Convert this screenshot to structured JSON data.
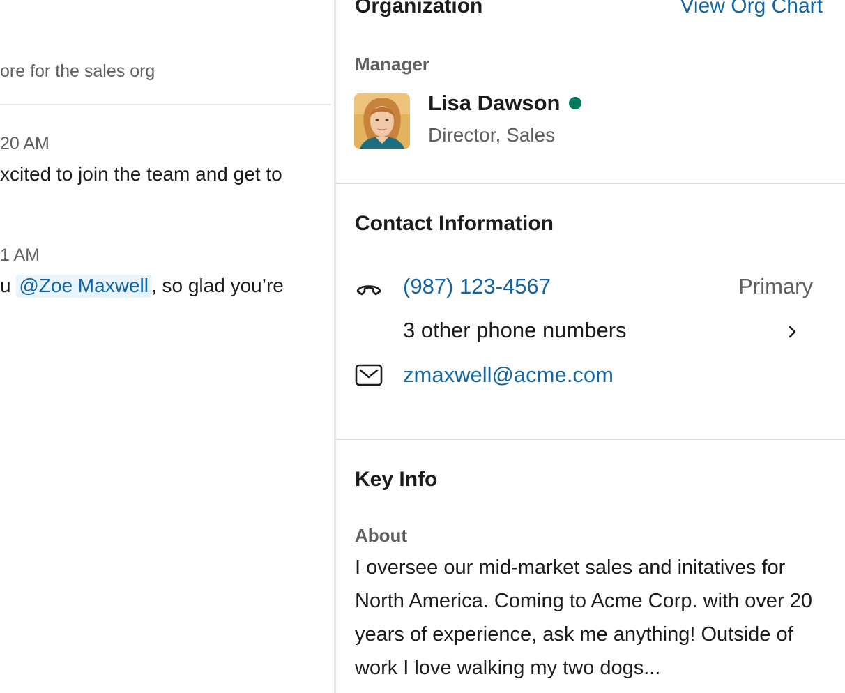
{
  "messages_pane": {
    "channel_topic": "ore for the sales org",
    "messages": [
      {
        "time": "20 AM",
        "text": "xcited to join the team and get to"
      },
      {
        "time": "1 AM",
        "text_prefix": "u ",
        "mention": "@Zoe Maxwell",
        "text_suffix": ", so glad you’re"
      }
    ]
  },
  "profile": {
    "organization": {
      "heading": "Organization",
      "org_chart_link": "View Org Chart",
      "manager_label": "Manager",
      "manager": {
        "name": "Lisa Dawson",
        "title": "Director, Sales",
        "status": "active",
        "status_color": "#007a5a"
      }
    },
    "contact": {
      "heading": "Contact Information",
      "phone": "(987) 123-4567",
      "phone_tag": "Primary",
      "other_numbers": "3 other phone numbers",
      "email": "zmaxwell@acme.com",
      "icons": [
        "phone-icon",
        "email-icon",
        "chevron-right-icon"
      ]
    },
    "key_info": {
      "heading": "Key Info",
      "about_label": "About",
      "about_text": "I oversee our mid-market sales and initatives for North America. Coming to Acme Corp. with over 20 years of experience, ask me anything! Outside of work I love walking my two dogs..."
    }
  },
  "colors": {
    "link": "#1264a3",
    "text": "#1d1c1d",
    "muted": "#616061",
    "presence": "#007a5a",
    "mention_bg": "#e8f3fb"
  }
}
